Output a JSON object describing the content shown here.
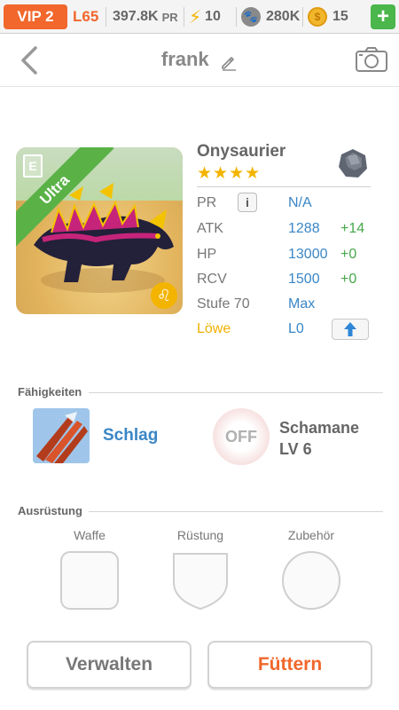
{
  "statusbar": {
    "vip": "VIP 2",
    "level": "L65",
    "power": "397.8K",
    "power_unit": "PR",
    "energy": "10",
    "food": "280K",
    "coins": "15",
    "icons": [
      "lightning-icon",
      "paw-icon",
      "coin-icon",
      "plus-icon"
    ]
  },
  "header": {
    "title": "frank"
  },
  "creature": {
    "name": "Onysaurier",
    "rarity": "Ultra",
    "stars": "★★★★",
    "stats": [
      {
        "label": "PR",
        "value": "N/A",
        "bonus": ""
      },
      {
        "label": "ATK",
        "value": "1288",
        "bonus": "+14"
      },
      {
        "label": "HP",
        "value": "13000",
        "bonus": "+0"
      },
      {
        "label": "RCV",
        "value": "1500",
        "bonus": "+0"
      },
      {
        "label": "Stufe 70",
        "value": "Max",
        "bonus": ""
      },
      {
        "label": "Löwe",
        "value": "L0",
        "bonus": ""
      }
    ]
  },
  "abilities": {
    "heading": "Fähigkeiten",
    "skill_name": "Schlag",
    "passive_state": "OFF",
    "passive_line1": "Schamane",
    "passive_line2": "LV 6"
  },
  "equipment": {
    "heading": "Ausrüstung",
    "slots": [
      "Waffe",
      "Rüstung",
      "Zubehör"
    ]
  },
  "buttons": {
    "manage": "Verwalten",
    "feed": "Füttern"
  },
  "colors": {
    "accent_orange": "#f1672c",
    "value_blue": "#3a86c6",
    "bonus_green": "#46a84a",
    "gold": "#f3b400"
  }
}
